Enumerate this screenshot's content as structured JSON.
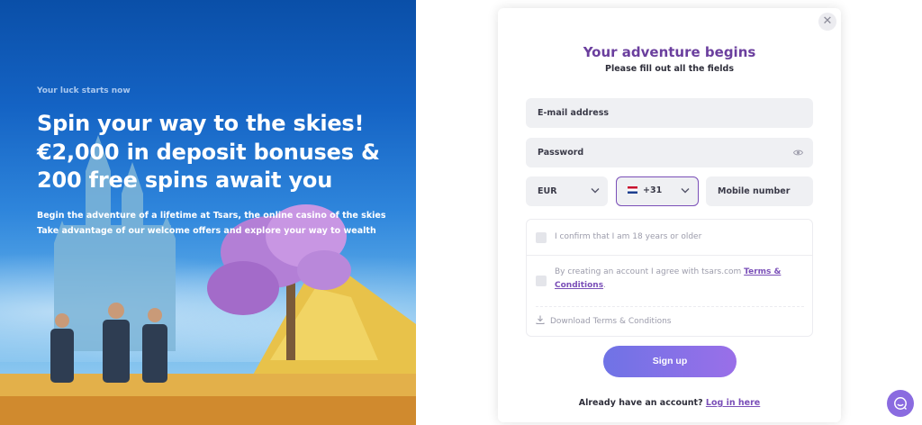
{
  "hero": {
    "tagline": "Your luck starts now",
    "headline": "Spin your way to the skies!\n€2,000 in deposit bonuses &\n200 free spins await you",
    "desc_line1": "Begin the adventure of a lifetime at Tsars, the online casino of the skies",
    "desc_line2": "Take advantage of our welcome offers and explore your way to wealth"
  },
  "form": {
    "title": "Your adventure begins",
    "subtitle": "Please fill out all the fields",
    "email_placeholder": "E-mail address",
    "password_placeholder": "Password",
    "currency": "EUR",
    "phone_code": "+31",
    "mobile_placeholder": "Mobile number",
    "age_confirm": "I confirm that I am 18 years or older",
    "terms_prefix": "By creating an account I agree with tsars.com ",
    "terms_link": "Terms & Conditions",
    "terms_suffix": ".",
    "download_terms": "Download Terms & Conditions",
    "signup_label": "Sign up",
    "login_prompt": "Already have an account? ",
    "login_link": "Log in here",
    "close_symbol": "✕"
  },
  "colors": {
    "accent": "#7a4fb8",
    "title": "#6b3f9e",
    "button_start": "#6f73e6",
    "button_end": "#9a6fe8"
  },
  "icons": [
    "close-icon",
    "eye-icon",
    "chevron-down-icon",
    "netherlands-flag-icon",
    "download-icon",
    "chat-icon"
  ]
}
